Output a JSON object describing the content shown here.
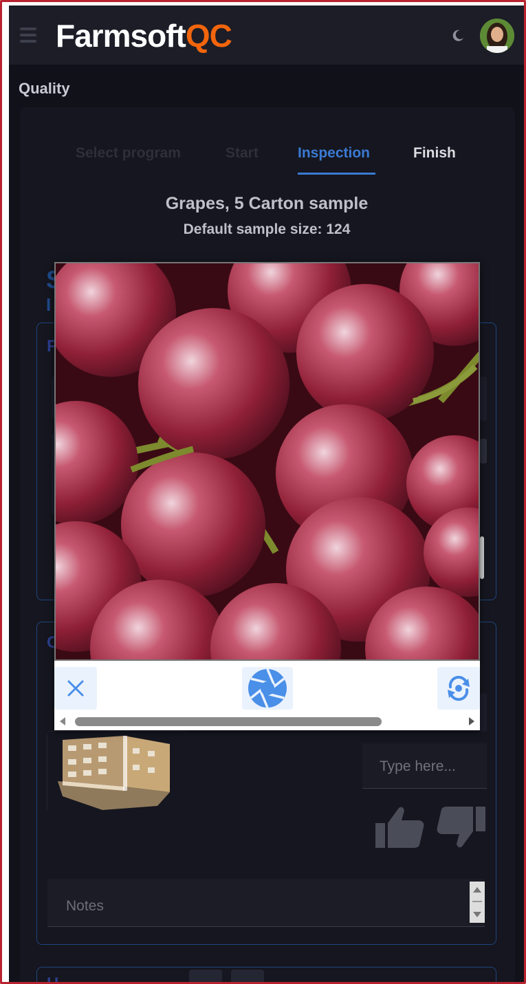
{
  "app": {
    "logo_part1": "Farmsoft",
    "logo_part2": "QC",
    "brand_color": "#f2650d",
    "accent_color": "#3a7ad3"
  },
  "header": {
    "menu_icon": "hamburger-icon",
    "theme_icon": "moon-icon",
    "avatar_icon": "user-avatar"
  },
  "page": {
    "section_title": "Quality"
  },
  "stepper": {
    "steps": [
      {
        "label": "Select program",
        "state": "completed"
      },
      {
        "label": "Start",
        "state": "completed"
      },
      {
        "label": "Inspection",
        "state": "active"
      },
      {
        "label": "Finish",
        "state": "upcoming"
      }
    ]
  },
  "inspection": {
    "title": "Grapes, 5 Carton sample",
    "default_sample_size": "Default sample size: 124"
  },
  "background_form": {
    "type_here_placeholder": "Type here...",
    "notes_placeholder": "Notes"
  },
  "camera": {
    "close_icon": "close-icon",
    "shutter_icon": "camera-shutter-icon",
    "switch_icon": "switch-camera-icon"
  }
}
